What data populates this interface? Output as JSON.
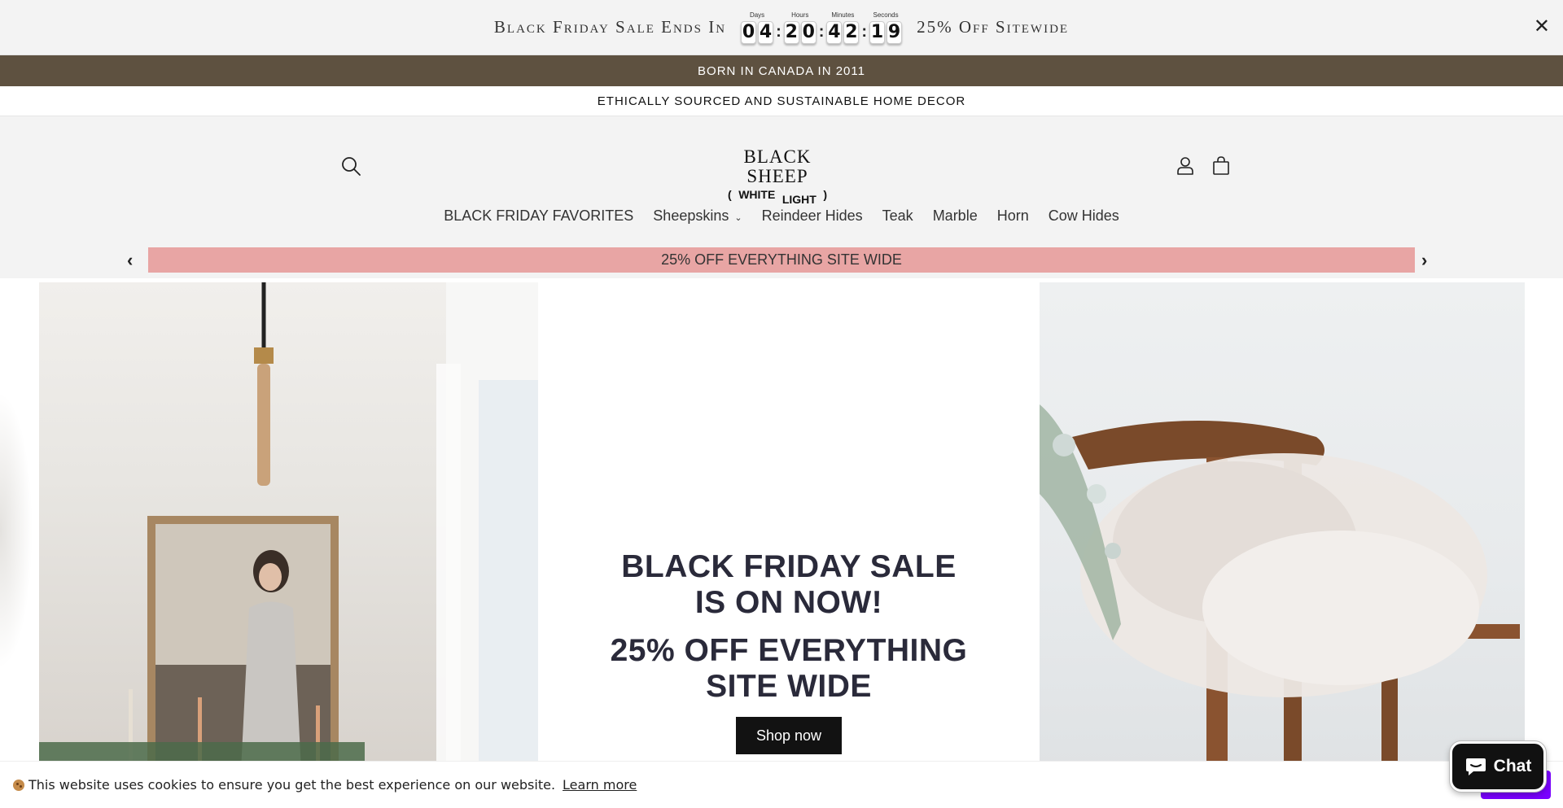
{
  "countdown": {
    "prefix": "Black Friday Sale Ends In",
    "suffix": "25% Off Sitewide",
    "labels": {
      "days": "Days",
      "hours": "Hours",
      "minutes": "Minutes",
      "seconds": "Seconds"
    },
    "days": [
      "0",
      "4"
    ],
    "hours": [
      "2",
      "0"
    ],
    "minutes": [
      "4",
      "2"
    ],
    "seconds": [
      "1",
      "9"
    ],
    "close": "✕"
  },
  "announcement": {
    "top": "BORN IN CANADA IN 2011",
    "second": "ETHICALLY SOURCED AND SUSTAINABLE HOME DECOR"
  },
  "logo": {
    "line1": "BLACK SHEEP",
    "open": "(",
    "word1": "WHITE",
    "word2": "LIGHT",
    "close": ")"
  },
  "nav": {
    "items": [
      "BLACK FRIDAY FAVORITES",
      "Sheepskins",
      "Reindeer Hides",
      "Teak",
      "Marble",
      "Horn",
      "Cow Hides"
    ],
    "caret": "⌄"
  },
  "promo": {
    "text": "25% OFF EVERYTHING SITE WIDE",
    "prev": "‹",
    "next": "›"
  },
  "hero": {
    "heading_line1": "BLACK FRIDAY SALE",
    "heading_line2": "IS ON NOW!",
    "sub_line1": "25% OFF EVERYTHING",
    "sub_line2": "SITE WIDE",
    "button": "Shop now"
  },
  "cookie": {
    "text": "This website uses cookies to ensure you get the best experience on our website.",
    "link": "Learn more"
  },
  "chat": {
    "label": "Chat"
  },
  "colors": {
    "brown_bar": "#5e5140",
    "promo_pink": "#e8a5a4",
    "accept_purple": "#7a00ff",
    "header_bg": "#f3f3f3"
  },
  "icons": [
    "search-icon",
    "account-icon",
    "cart-icon",
    "close-icon",
    "chevron-left-icon",
    "chevron-right-icon",
    "chat-bubble-icon",
    "cookie-icon"
  ]
}
